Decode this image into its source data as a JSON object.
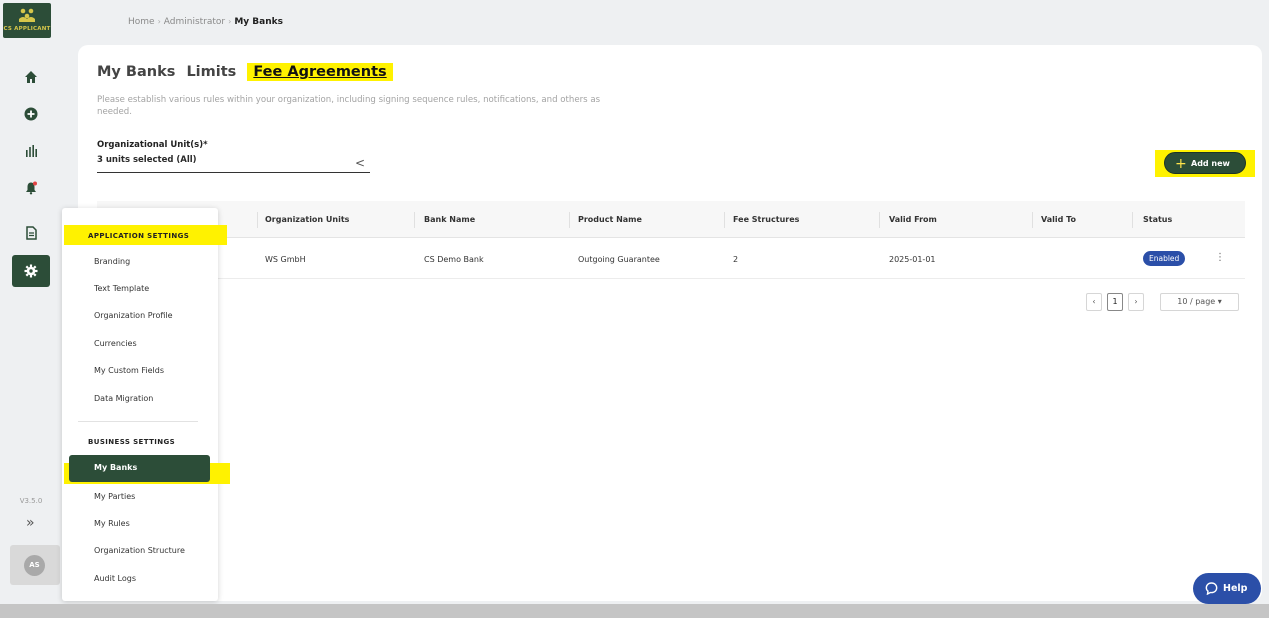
{
  "logo": {
    "text": "CS APPLICANT"
  },
  "breadcrumb": {
    "home": "Home",
    "admin": "Administrator",
    "current": "My Banks",
    "sep": "›"
  },
  "rail": {
    "version": "V3.5.0",
    "expand_glyph": "»",
    "avatar_initials": "AS"
  },
  "tabs": {
    "my_banks": "My Banks",
    "limits": "Limits",
    "fee_agreements": "Fee Agreements"
  },
  "description": "Please establish various rules within your organization, including signing sequence rules, notifications, and others as needed.",
  "filter": {
    "label": "Organizational Unit(s)*",
    "value": "3 units selected (All)",
    "chevron": "<"
  },
  "add_button": {
    "plus": "+",
    "label": "Add new"
  },
  "table": {
    "headers": {
      "org_units": "Organization Units",
      "bank": "Bank Name",
      "product": "Product Name",
      "fees": "Fee Structures",
      "from": "Valid From",
      "to": "Valid To",
      "status": "Status"
    },
    "rows": [
      {
        "org_units": "WS GmbH",
        "bank": "CS Demo Bank",
        "product": "Outgoing Guarantee",
        "fees": "2",
        "from": "2025-01-01",
        "to": "",
        "status": "Enabled",
        "more": "⋮"
      }
    ]
  },
  "pagination": {
    "prev": "‹",
    "page": "1",
    "next": "›",
    "per_page": "10 / page ▾"
  },
  "menu": {
    "application_settings": "APPLICATION SETTINGS",
    "app_items": [
      "Branding",
      "Text Template",
      "Organization Profile",
      "Currencies",
      "My Custom Fields",
      "Data Migration"
    ],
    "business_settings": "BUSINESS SETTINGS",
    "active_item": "My Banks",
    "business_items": [
      "My Parties",
      "My Rules",
      "Organization Structure",
      "Audit Logs"
    ]
  },
  "help": {
    "label": "Help"
  },
  "colors": {
    "brand_green": "#2c4d38",
    "highlight": "#fff200",
    "badge_blue": "#2b4fa8"
  }
}
